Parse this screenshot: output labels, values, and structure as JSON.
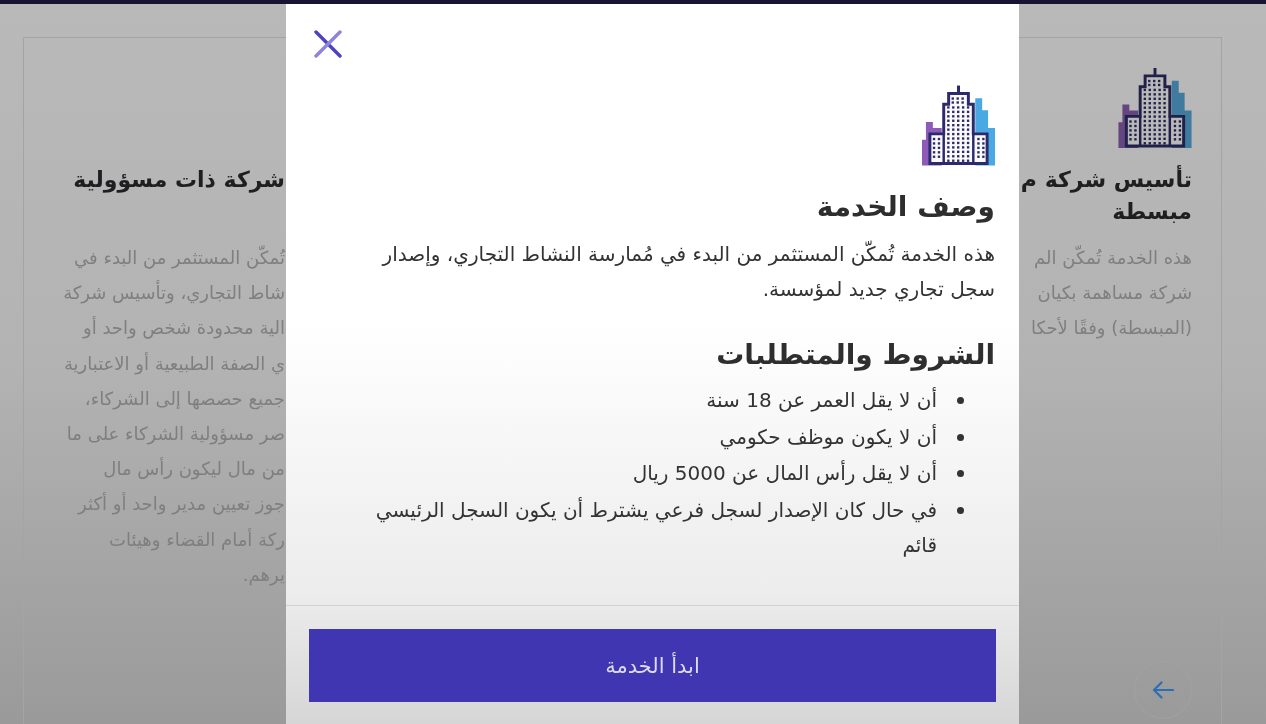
{
  "background_cards": [
    {
      "icon": true,
      "title_lines": [
        "تأسيس شركة م",
        "مبسطة"
      ],
      "body_lines": [
        "هذه الخدمة تُمكّن الم",
        "شركة مساهمة بكيان",
        "(المبسطة) وفقًا لأحكا"
      ]
    },
    {
      "title_lines": [
        "شركة ذات مسؤولية"
      ],
      "body_lines": [
        "تُمكّن المستثمر من البدء في",
        "شاط التجاري، وتأسيس شركة",
        "الية محدودة شخص واحد أو",
        "ي الصفة الطبيعية أو الاعتبارية",
        "جميع حصصها إلى الشركاء،",
        "صر مسؤولية الشركاء على ما",
        "من مال ليكون رأس مال",
        "جوز تعيين مدير واحد أو أكثر",
        "ركة أمام القضاء وهيئات",
        "يرهم."
      ]
    }
  ],
  "modal": {
    "sections": [
      {
        "kind": "paragraph",
        "heading": "وصف الخدمة",
        "text": "هذه الخدمة تُمكّن المستثمر من البدء في مُمارسة النشاط التجاري، وإصدار سجل تجاري جديد لمؤسسة."
      },
      {
        "kind": "bullets",
        "heading": "الشروط والمتطلبات",
        "items": [
          "أن لا يقل العمر عن 18 سنة",
          "أن لا يكون موظف حكومي",
          "أن لا يقل رأس المال عن 5000 ريال",
          "في حال كان الإصدار لسجل فرعي يشترط أن يكون السجل الرئيسي قائم"
        ]
      }
    ],
    "start_button": "ابدأ الخدمة"
  }
}
